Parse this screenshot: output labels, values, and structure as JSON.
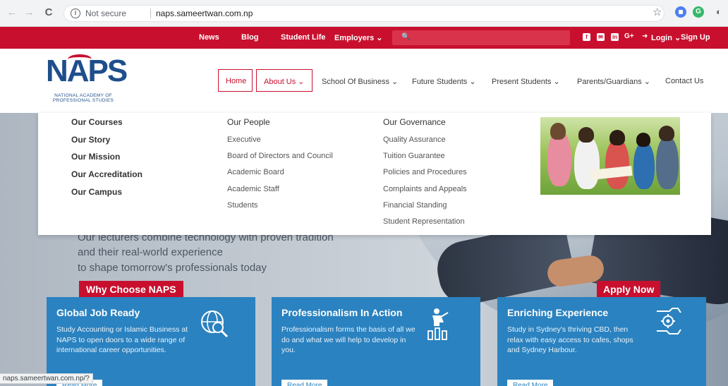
{
  "browser": {
    "security_text": "Not secure",
    "url": "naps.sameertwan.com.np",
    "back_glyph": "←",
    "forward_glyph": "→",
    "reload_glyph": "C",
    "star_glyph": "☆",
    "ext2_label": "G"
  },
  "topbar": {
    "links": [
      "News",
      "Blog",
      "Student Life",
      "Employers ⌄"
    ],
    "login": "Login ⌄",
    "signup": "Sign Up",
    "social_icons": [
      "facebook-icon",
      "email-icon",
      "linkedin-icon",
      "google-plus-icon"
    ],
    "social_glyphs": [
      "f",
      "✉",
      "in"
    ],
    "gplus_text": "G+",
    "search_glyph": "🔍",
    "login_glyph": "➜"
  },
  "logo": {
    "mark": "NAPS",
    "line1": "NATIONAL ACADEMY OF",
    "line2": "PROFESSIONAL STUDIES"
  },
  "mainnav": {
    "items": [
      "Home",
      "About Us ⌄",
      "School Of Business ⌄",
      "Future Students ⌄",
      "Present Students ⌄",
      "Parents/Guardians ⌄",
      "Contact Us"
    ]
  },
  "mega_menu": {
    "col1": [
      "Our Courses",
      "Our Story",
      "Our Mission",
      "Our Accreditation",
      "Our Campus"
    ],
    "col2_heading": "Our People",
    "col2": [
      "Executive",
      "Board of Directors and Council",
      "Academic Board",
      "Academic Staff",
      "Students"
    ],
    "col3_heading": "Our Governance",
    "col3": [
      "Quality Assurance",
      "Tuition Guarantee",
      "Policies and Procedures",
      "Complaints and Appeals",
      "Financial Standing",
      "Student Representation"
    ]
  },
  "hero": {
    "line1": "Our lecturers combine technology with proven tradition",
    "line2": "and their real-world experience",
    "line3": "to shape tomorrow's professionals today",
    "cta_left": "Why Choose NAPS",
    "cta_right": "Apply Now"
  },
  "cards": [
    {
      "title": "Global Job Ready",
      "body": "Study Accounting or Islamic Business at NAPS to open doors to a wide range of international career opportunities.",
      "read_more": "Read More"
    },
    {
      "title": "Professionalism In Action",
      "body": "Professionalism forms the basis of all we do and what we will help to develop in you.",
      "read_more": "Read More"
    },
    {
      "title": "Enriching Experience",
      "body": "Study in Sydney's thriving CBD, then relax with easy access to cafes, shops and Sydney Harbour.",
      "read_more": "Read More"
    }
  ],
  "status_bar": {
    "text": "naps.sameertwan.com.np/?"
  },
  "colors": {
    "brand_red": "#c8102e",
    "brand_blue": "#1e4e8c",
    "card_blue": "#2a82c0"
  }
}
